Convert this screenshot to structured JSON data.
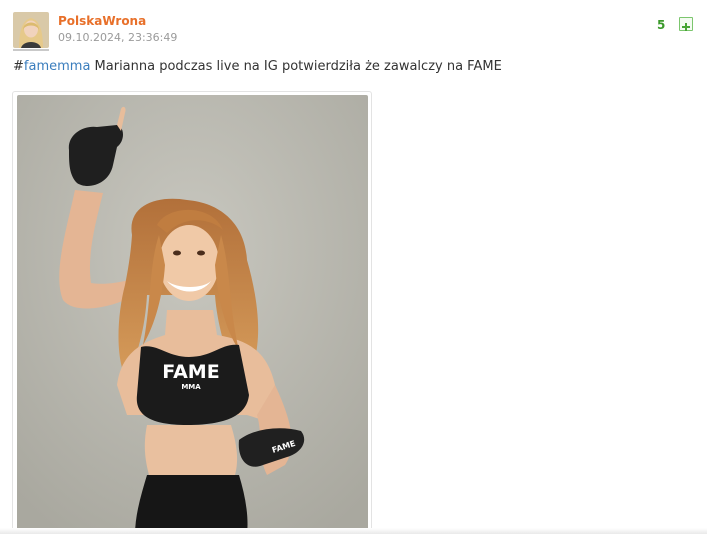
{
  "entry": {
    "author": "PolskaWrona",
    "date": "09.10.2024, 23:36:49",
    "votes": "5",
    "hash": "#",
    "tag": "famemma",
    "text": " Marianna podczas live na IG potwierdziła że zawalczy na FAME"
  },
  "colors": {
    "author": "#e8702a",
    "tag": "#3a7dbd",
    "votes": "#3b9a2b"
  },
  "icons": {
    "vote": "plus-icon"
  },
  "photo": {
    "shirt_text": "FAME",
    "shirt_subtext": "MMA",
    "glove_text": "FAME"
  }
}
